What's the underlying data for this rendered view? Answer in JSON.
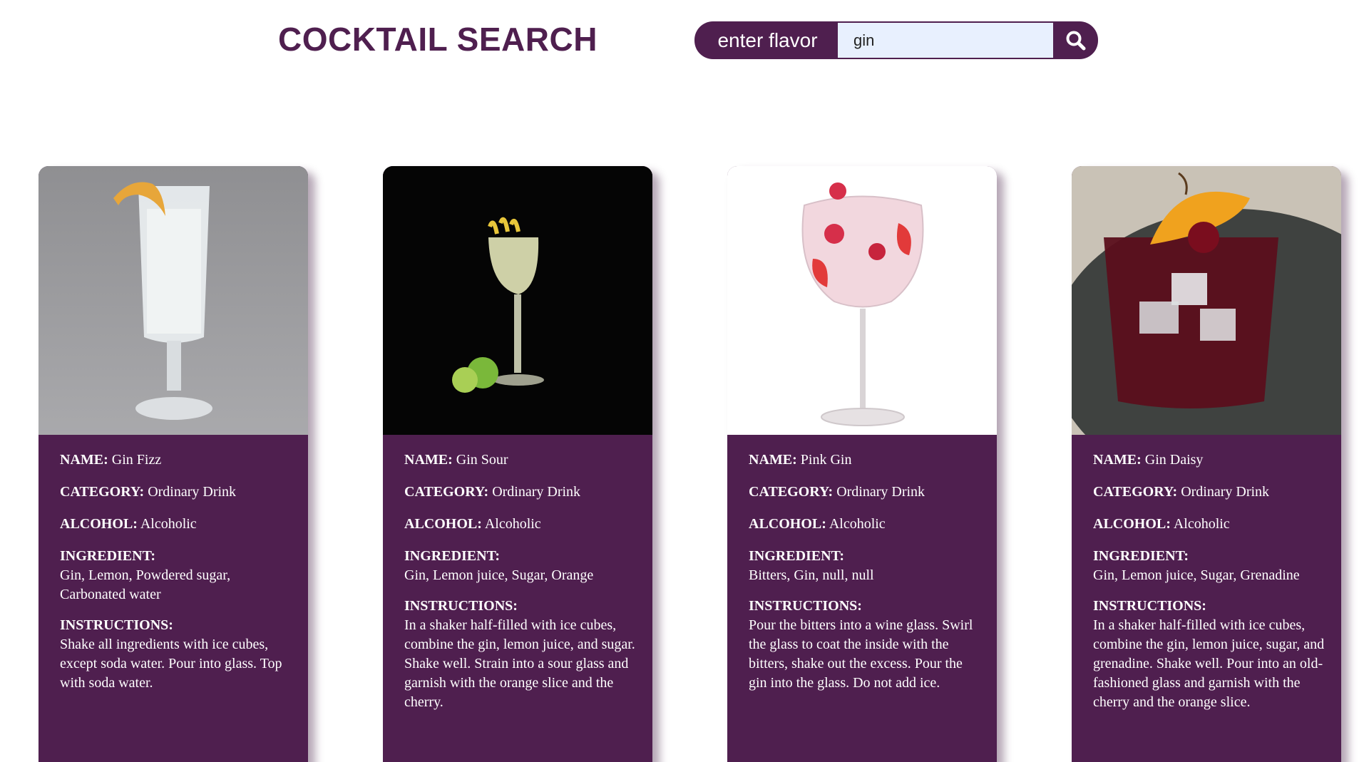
{
  "header": {
    "title": "COCKTAIL SEARCH"
  },
  "search": {
    "label": "enter flavor",
    "value": "gin",
    "button_icon": "search-icon"
  },
  "field_labels": {
    "name": "NAME:",
    "category": "CATEGORY:",
    "alcohol": "ALCOHOL:",
    "ingredient": "INGREDIENT:",
    "instructions": "INSTRUCTIONS:"
  },
  "cards": [
    {
      "name": "Gin Fizz",
      "category": "Ordinary Drink",
      "alcohol": "Alcoholic",
      "ingredients": "Gin, Lemon, Powdered sugar, Carbonated water",
      "instructions": "Shake all ingredients with ice cubes, except soda water. Pour into glass. Top with soda water."
    },
    {
      "name": "Gin Sour",
      "category": "Ordinary Drink",
      "alcohol": "Alcoholic",
      "ingredients": "Gin, Lemon juice, Sugar, Orange",
      "instructions": "In a shaker half-filled with ice cubes, combine the gin, lemon juice, and sugar. Shake well. Strain into a sour glass and garnish with the orange slice and the cherry."
    },
    {
      "name": "Pink Gin",
      "category": "Ordinary Drink",
      "alcohol": "Alcoholic",
      "ingredients": "Bitters, Gin, null, null",
      "instructions": "Pour the bitters into a wine glass. Swirl the glass to coat the inside with the bitters, shake out the excess. Pour the gin into the glass. Do not add ice."
    },
    {
      "name": "Gin Daisy",
      "category": "Ordinary Drink",
      "alcohol": "Alcoholic",
      "ingredients": "Gin, Lemon juice, Sugar, Grenadine",
      "instructions": "In a shaker half-filled with ice cubes, combine the gin, lemon juice, sugar, and grenadine. Shake well. Pour into an old-fashioned glass and garnish with the cherry and the orange slice."
    }
  ],
  "colors": {
    "brand": "#4f1f4f",
    "input_bg": "#e8f0fe"
  }
}
